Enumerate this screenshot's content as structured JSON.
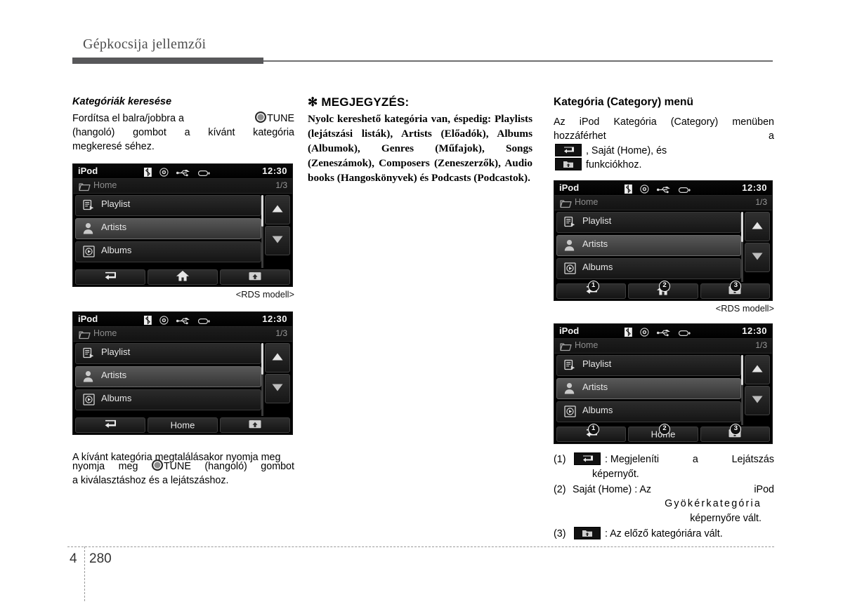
{
  "header": {
    "title": "Gépkocsija jellemzői"
  },
  "footer": {
    "chapter": "4",
    "page": "280"
  },
  "col1": {
    "subhead": "Kategóriák keresése",
    "para1_a": "Fordítsa el balra/jobbra a",
    "para1_knob": "TUNE",
    "para1_b": "(hangoló) gombot a kívánt kategória megkeresésé hez.",
    "para1_line2": "(hangoló) gombot a kívánt kategória",
    "para1_line3": "megkeresé séhez.",
    "caption_rds": "<RDS modell>",
    "para2_a": "A kívánt kategória megtalálásakor nyomja meg",
    "para2_knob": "TUNE",
    "para2_b": "(hangoló) gombot a kiválasztáshoz és a lejátszáshoz.",
    "para2_line2_tail": "(hangoló) gombot",
    "para2_line3": "a kiválasztáshoz és a lejátszáshoz."
  },
  "col2": {
    "note_title": "MEGJEGYZÉS:",
    "note_star": "✻",
    "note_body": "Nyolc kereshető kategória van, éspedig: Playlists (lejátszási listák), Artists (Előadók), Albums (Albumok), Genres (Műfajok), Songs (Zeneszámok), Composers (Zeneszerzők), Audio books (Hangoskönyvek) és Podcasts (Podcastok)."
  },
  "col3": {
    "section_title": "Kategória (Category) menü",
    "intro_a": "Az iPod Kategória (Category) menüben hozzáférhet a",
    "intro_b": ", Saját (Home), és",
    "intro_c": "funkciókhoz.",
    "caption_rds": "<RDS modell>",
    "explanations": [
      {
        "num": "(1)",
        "icon": "back-icon",
        "text_a": ": Megjeleníti",
        "text_b": "a",
        "text_c": "Lejátszás",
        "text_d": "képernyőt."
      },
      {
        "num": "(2)",
        "label": "Saját (Home) : Az",
        "text_b": "iPod",
        "text_c": "Gyökérkategória",
        "text_d": "képernyőre vált."
      },
      {
        "num": "(3)",
        "icon": "folder-up-icon",
        "text_a": ": Az előző kategóriára vált."
      }
    ]
  },
  "device": {
    "source": "iPod",
    "clock": "12:30",
    "breadcrumb": "Home",
    "page_indicator": "1/3",
    "status_icons": [
      "bluetooth-icon",
      "disc-icon",
      "usb-icon",
      "aux-device-icon"
    ],
    "rows": [
      {
        "label": "Playlist",
        "icon": "playlist-icon",
        "selected": false
      },
      {
        "label": "Artists",
        "icon": "person-icon",
        "selected": true
      },
      {
        "label": "Albums",
        "icon": "album-icon",
        "selected": false
      }
    ],
    "buttons_icon": [
      {
        "icon": "back-icon"
      },
      {
        "icon": "home-icon"
      },
      {
        "icon": "folder-up-icon"
      }
    ],
    "buttons_text": [
      {
        "icon": "back-icon"
      },
      {
        "label": "Home"
      },
      {
        "icon": "folder-up-icon"
      }
    ],
    "badges": [
      "1",
      "2",
      "3"
    ]
  },
  "colors": {
    "rule": "#58585a",
    "screen_bg": "#000000",
    "text": "#000000",
    "row_selected": "#585858"
  }
}
